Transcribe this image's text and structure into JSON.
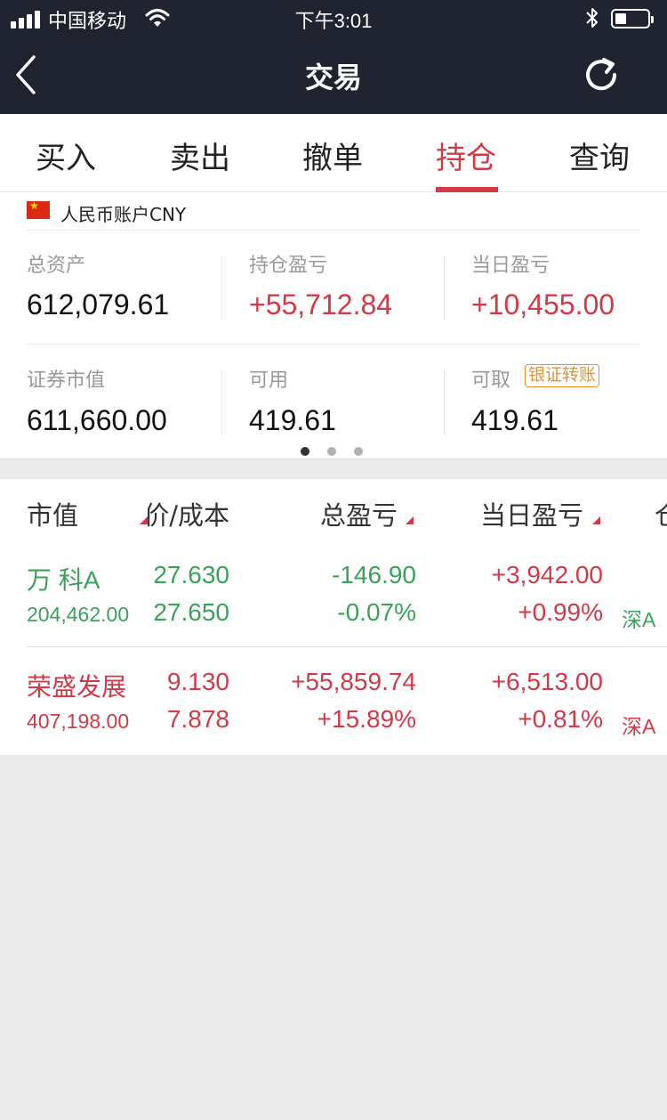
{
  "status_bar": {
    "carrier": "中国移动",
    "time": "下午3:01"
  },
  "nav": {
    "title": "交易",
    "icons": {
      "back": "chevron-left-icon",
      "refresh": "refresh-icon"
    }
  },
  "tabs": [
    {
      "label": "买入"
    },
    {
      "label": "卖出"
    },
    {
      "label": "撤单"
    },
    {
      "label": "持仓",
      "active": true
    },
    {
      "label": "查询"
    }
  ],
  "account": {
    "name": "人民币账户CNY",
    "total_assets": {
      "label": "总资产",
      "value": "612,079.61"
    },
    "position_pl": {
      "label": "持仓盈亏",
      "value": "+55,712.84"
    },
    "daily_pl": {
      "label": "当日盈亏",
      "value": "+10,455.00"
    },
    "market_value": {
      "label": "证券市值",
      "value": "611,660.00"
    },
    "available": {
      "label": "可用",
      "value": "419.61"
    },
    "withdrawable": {
      "label": "可取",
      "value": "419.61"
    },
    "transfer_button": "银证转账",
    "pager": {
      "pages": 3,
      "current": 1
    }
  },
  "holdings": {
    "columns": [
      "市值",
      "价/成本",
      "总盈亏",
      "当日盈亏",
      "仓"
    ],
    "rows": [
      {
        "name": "万 科A",
        "market_value": "204,462.00",
        "price": "27.630",
        "cost": "27.650",
        "total_pl": "-146.90",
        "total_pl_pct": "-0.07%",
        "daily_pl": "+3,942.00",
        "daily_pl_pct": "+0.99%",
        "market": "深A"
      },
      {
        "name": "荣盛发展",
        "market_value": "407,198.00",
        "price": "9.130",
        "cost": "7.878",
        "total_pl": "+55,859.74",
        "total_pl_pct": "+15.89%",
        "daily_pl": "+6,513.00",
        "daily_pl_pct": "+0.81%",
        "market": "深A"
      }
    ]
  },
  "colors": {
    "header_bg": "#1f2430",
    "accent_red": "#d23a48",
    "gain_green": "#3aa35a",
    "badge_orange": "#e8922b"
  }
}
